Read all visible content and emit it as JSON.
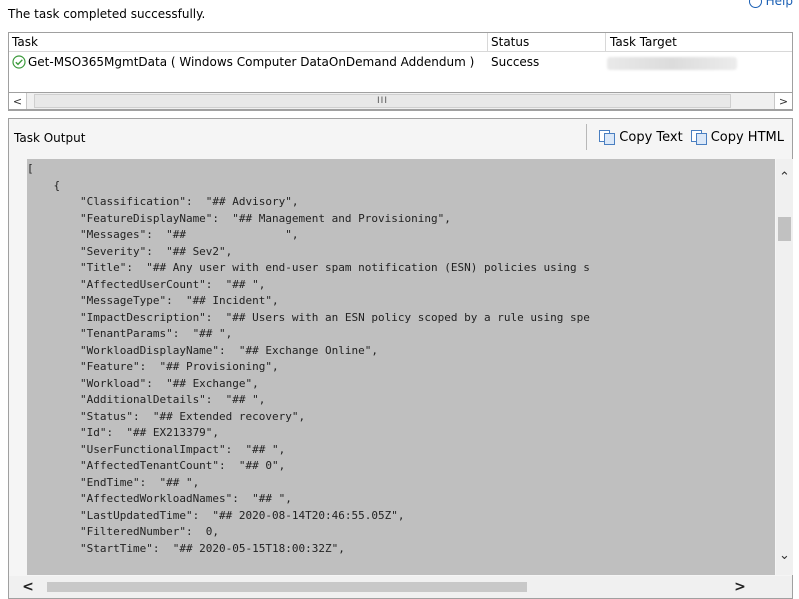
{
  "status_message": "The task completed successfully.",
  "help_label": "Help",
  "task_grid": {
    "headers": {
      "task": "Task",
      "status": "Status",
      "target": "Task Target"
    },
    "rows": [
      {
        "task": "Get-MSO365MgmtData ( Windows Computer DataOnDemand Addendum )",
        "status": "Success",
        "target": ""
      }
    ],
    "scroll_thumb_glyph": "III"
  },
  "output_panel": {
    "title": "Task Output",
    "copy_text_label": "Copy Text",
    "copy_html_label": "Copy HTML",
    "content": "[\n    {\n        \"Classification\":  \"## Advisory\",\n        \"FeatureDisplayName\":  \"## Management and Provisioning\",\n        \"Messages\":  \"##               \",\n        \"Severity\":  \"## Sev2\",\n        \"Title\":  \"## Any user with end-user spam notification (ESN) policies using s\n        \"AffectedUserCount\":  \"## \",\n        \"MessageType\":  \"## Incident\",\n        \"ImpactDescription\":  \"## Users with an ESN policy scoped by a rule using spe\n        \"TenantParams\":  \"## \",\n        \"WorkloadDisplayName\":  \"## Exchange Online\",\n        \"Feature\":  \"## Provisioning\",\n        \"Workload\":  \"## Exchange\",\n        \"AdditionalDetails\":  \"## \",\n        \"Status\":  \"## Extended recovery\",\n        \"Id\":  \"## EX213379\",\n        \"UserFunctionalImpact\":  \"## \",\n        \"AffectedTenantCount\":  \"## 0\",\n        \"EndTime\":  \"## \",\n        \"AffectedWorkloadNames\":  \"## \",\n        \"LastUpdatedTime\":  \"## 2020-08-14T20:46:55.05Z\",\n        \"FilteredNumber\":  0,\n        \"StartTime\":  \"## 2020-05-15T18:00:32Z\","
  }
}
